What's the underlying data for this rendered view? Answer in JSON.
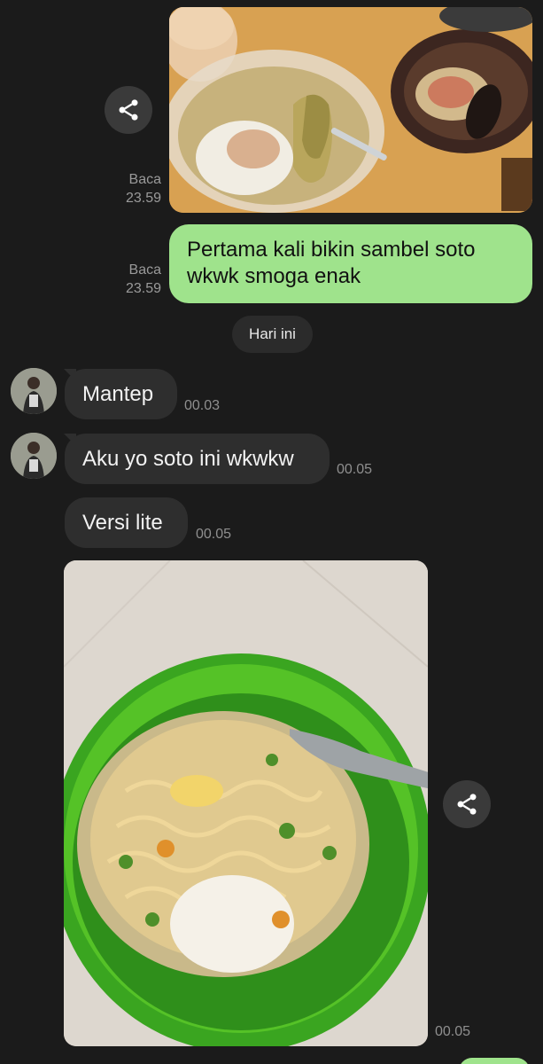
{
  "messages": {
    "out_photo": {
      "read_label": "Baca",
      "time": "23.59"
    },
    "out_text": {
      "line1": "Pertama kali bikin sambel soto",
      "line2": "wkwk smoga enak",
      "read_label": "Baca",
      "time": "23.59"
    },
    "date_separator": "Hari ini",
    "in_1": {
      "text": "Mantep",
      "time": "00.03"
    },
    "in_2": {
      "text": "Aku yo soto ini wkwkw",
      "time": "00.05"
    },
    "in_3": {
      "text": "Versi lite",
      "time": "00.05"
    },
    "in_photo": {
      "time": "00.05"
    }
  },
  "icons": {
    "share": "share-icon"
  },
  "colors": {
    "background": "#1b1b1b",
    "outgoing_bubble": "#9fe38c",
    "incoming_bubble": "#2e2e2e",
    "meta_text": "#9a9a9a"
  }
}
